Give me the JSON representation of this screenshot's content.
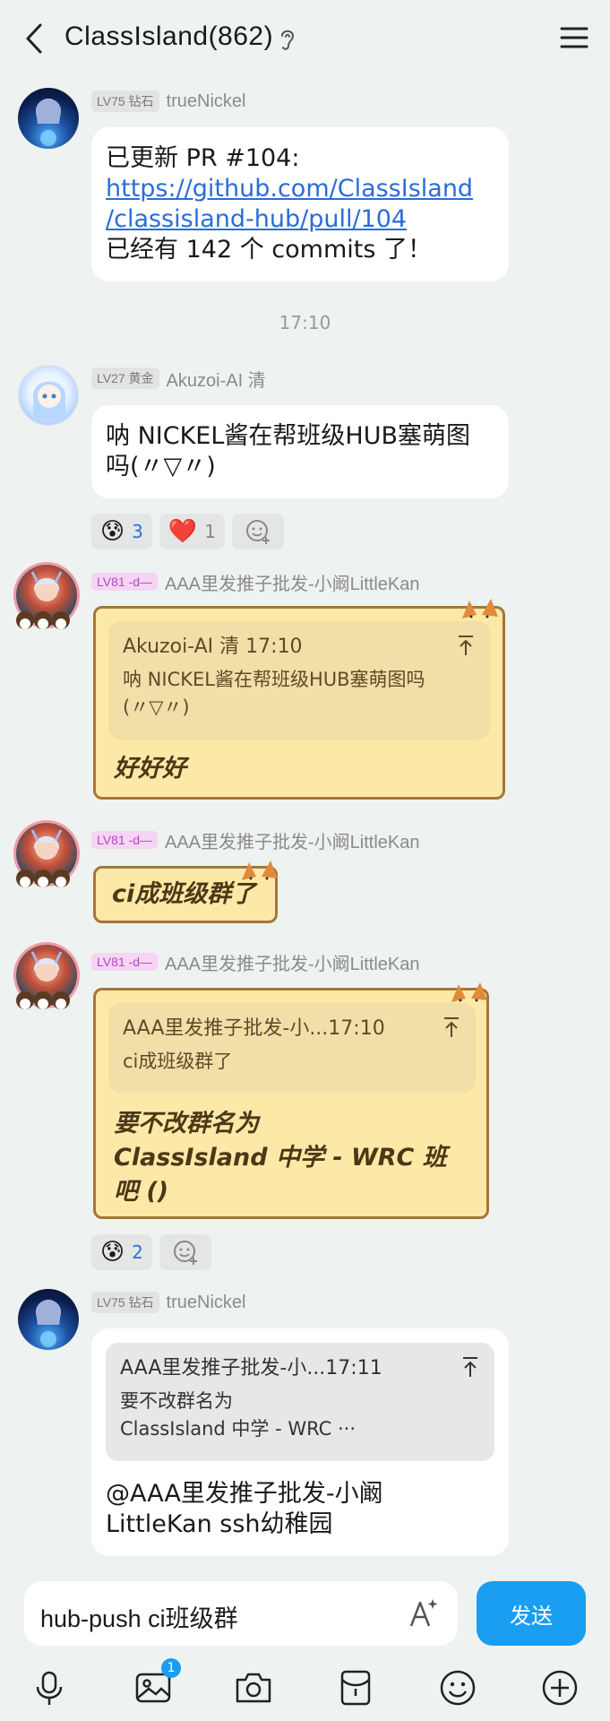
{
  "header": {
    "title": "ClassIsland(862)"
  },
  "time_separator": "17:10",
  "messages": [
    {
      "level": "LV75 钻石",
      "sender": "trueNickel",
      "line1": "已更新 PR #104:",
      "link_line1": "https://github.com/ClassIsland",
      "link_line2": "/classisland-hub/pull/104",
      "line3": "已经有 142 个 commits 了！"
    },
    {
      "level": "LV27 黄金",
      "sender": "Akuzoi-AI 清",
      "line1": "呐 NICKEL酱在帮班级HUB塞萌图",
      "line2": "吗(〃▽〃)",
      "reactions": [
        {
          "emoji": "😰",
          "count": "3"
        },
        {
          "emoji": "❤️",
          "count": "1"
        }
      ]
    },
    {
      "level": "LV81 -d—",
      "sender": "AAA里发推子批发-小阚LittleKan",
      "quote_head": "Akuzoi-AI 清 17:10",
      "quote_line1": "呐 NICKEL酱在帮班级HUB塞萌图吗",
      "quote_line2": "(〃▽〃)",
      "text": "好好好"
    },
    {
      "level": "LV81 -d—",
      "sender": "AAA里发推子批发-小阚LittleKan",
      "text": "ci成班级群了"
    },
    {
      "level": "LV81 -d—",
      "sender": "AAA里发推子批发-小阚LittleKan",
      "quote_head": "AAA里发推子批发-小...17:10",
      "quote_line1": "ci成班级群了",
      "line1": "要不改群名为",
      "line2": "ClassIsland 中学 - WRC 班",
      "line3": "吧 ()",
      "reactions": [
        {
          "emoji": "😰",
          "count": "2"
        }
      ]
    },
    {
      "level": "LV75 钻石",
      "sender": "trueNickel",
      "quote_head": "AAA里发推子批发-小...17:11",
      "quote_line1": "要不改群名为",
      "quote_line2": "ClassIsland 中学 - WRC ···",
      "line1": "@AAA里发推子批发-小阚",
      "line2": "LittleKan ssh幼稚园"
    }
  ],
  "input": {
    "value": "hub-push ci班级群",
    "send_label": "发送"
  },
  "toolbar": {
    "image_badge": "1"
  },
  "colors": {
    "accent": "#1a9ef2",
    "background": "#eef2f0",
    "yellow_bubble": "#fde9a7",
    "link": "#2a6dd9"
  }
}
